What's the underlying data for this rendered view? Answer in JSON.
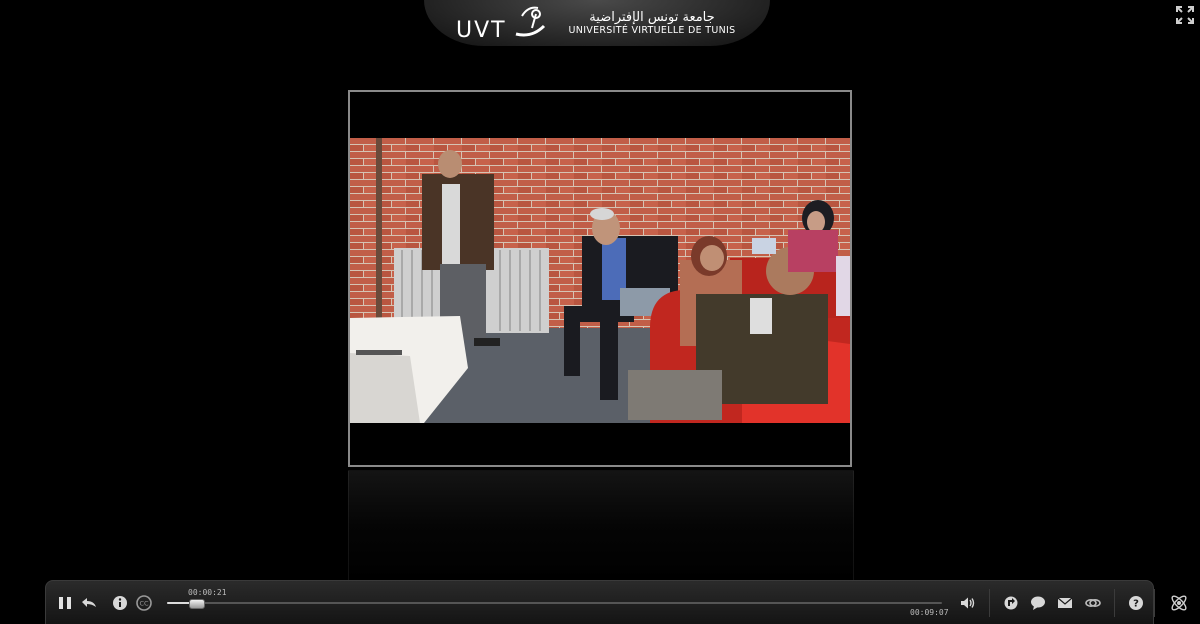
{
  "header": {
    "logo_letters": "UVT",
    "arabic_name": "جامعة تونس الإفتراضية",
    "latin_name": "UNIVERSITÉ VIRTUELLE DE TUNIS"
  },
  "player": {
    "current_time": "00:00:21",
    "total_time": "00:09:07",
    "progress": 0.038
  },
  "icons": {
    "fullscreen": "fullscreen-icon",
    "pause": "pause-icon",
    "rewind": "back-arrow-icon",
    "info": "info-icon",
    "captions": "cc-icon",
    "volume": "speaker-icon",
    "replay": "replay-icon",
    "comment": "speech-bubble-icon",
    "email": "envelope-icon",
    "link": "link-icon",
    "help": "help-icon",
    "brand": "atom-icon"
  }
}
